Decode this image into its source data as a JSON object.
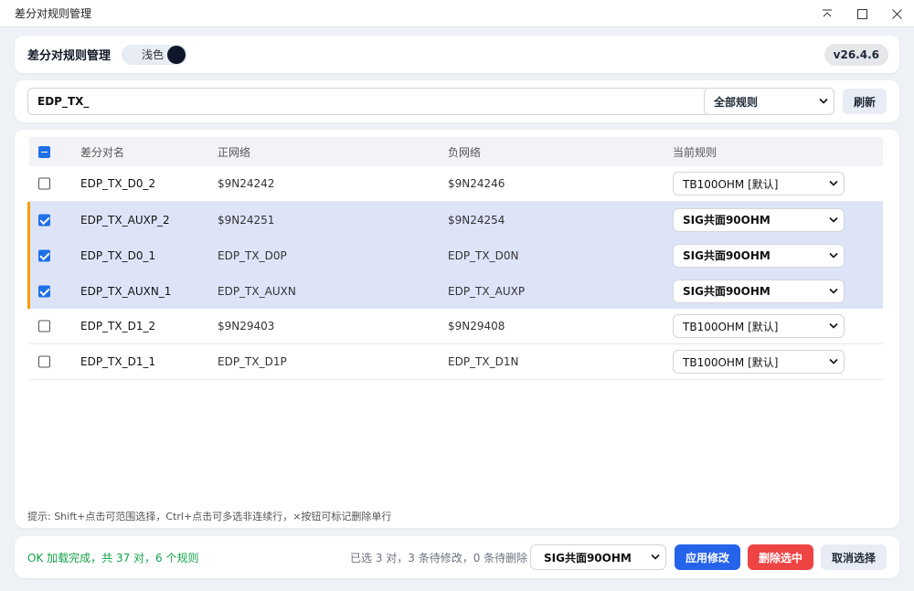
{
  "window": {
    "title": "差分对规则管理"
  },
  "header": {
    "title": "差分对规则管理",
    "theme_label": "浅色",
    "version": "v26.4.6"
  },
  "search": {
    "value": "EDP_TX_",
    "filter_value": "全部规则",
    "refresh_label": "刷新"
  },
  "table": {
    "columns": [
      "差分对名",
      "正网络",
      "负网络",
      "当前规则"
    ],
    "rows": [
      {
        "name": "EDP_TX_D0_2",
        "pos": "$9N24242",
        "neg": "$9N24246",
        "rule": "TB100OHM [默认]",
        "selected": false
      },
      {
        "name": "EDP_TX_AUXP_2",
        "pos": "$9N24251",
        "neg": "$9N24254",
        "rule": "SIG共面90OHM",
        "selected": true
      },
      {
        "name": "EDP_TX_D0_1",
        "pos": "EDP_TX_D0P",
        "neg": "EDP_TX_D0N",
        "rule": "SIG共面90OHM",
        "selected": true
      },
      {
        "name": "EDP_TX_AUXN_1",
        "pos": "EDP_TX_AUXN",
        "neg": "EDP_TX_AUXP",
        "rule": "SIG共面90OHM",
        "selected": true
      },
      {
        "name": "EDP_TX_D1_2",
        "pos": "$9N29403",
        "neg": "$9N29408",
        "rule": "TB100OHM [默认]",
        "selected": false
      },
      {
        "name": "EDP_TX_D1_1",
        "pos": "EDP_TX_D1P",
        "neg": "EDP_TX_D1N",
        "rule": "TB100OHM [默认]",
        "selected": false
      }
    ],
    "hint": "提示: Shift+点击可范围选择，Ctrl+点击可多选非连续行，×按钮可标记删除单行"
  },
  "footer": {
    "status": "OK 加载完成，共 37 对，6 个规则",
    "selection_summary": "已选 3 对，3 条待修改，0 条待删除",
    "bulk_rule": "SIG共面90OHM",
    "apply_label": "应用修改",
    "delete_label": "删除选中",
    "cancel_label": "取消选择"
  },
  "colors": {
    "accent": "#2563eb",
    "danger": "#ef4444",
    "selected_row": "#dde4f8",
    "row_marker": "#f59e0b",
    "status_ok": "#16a34a"
  }
}
